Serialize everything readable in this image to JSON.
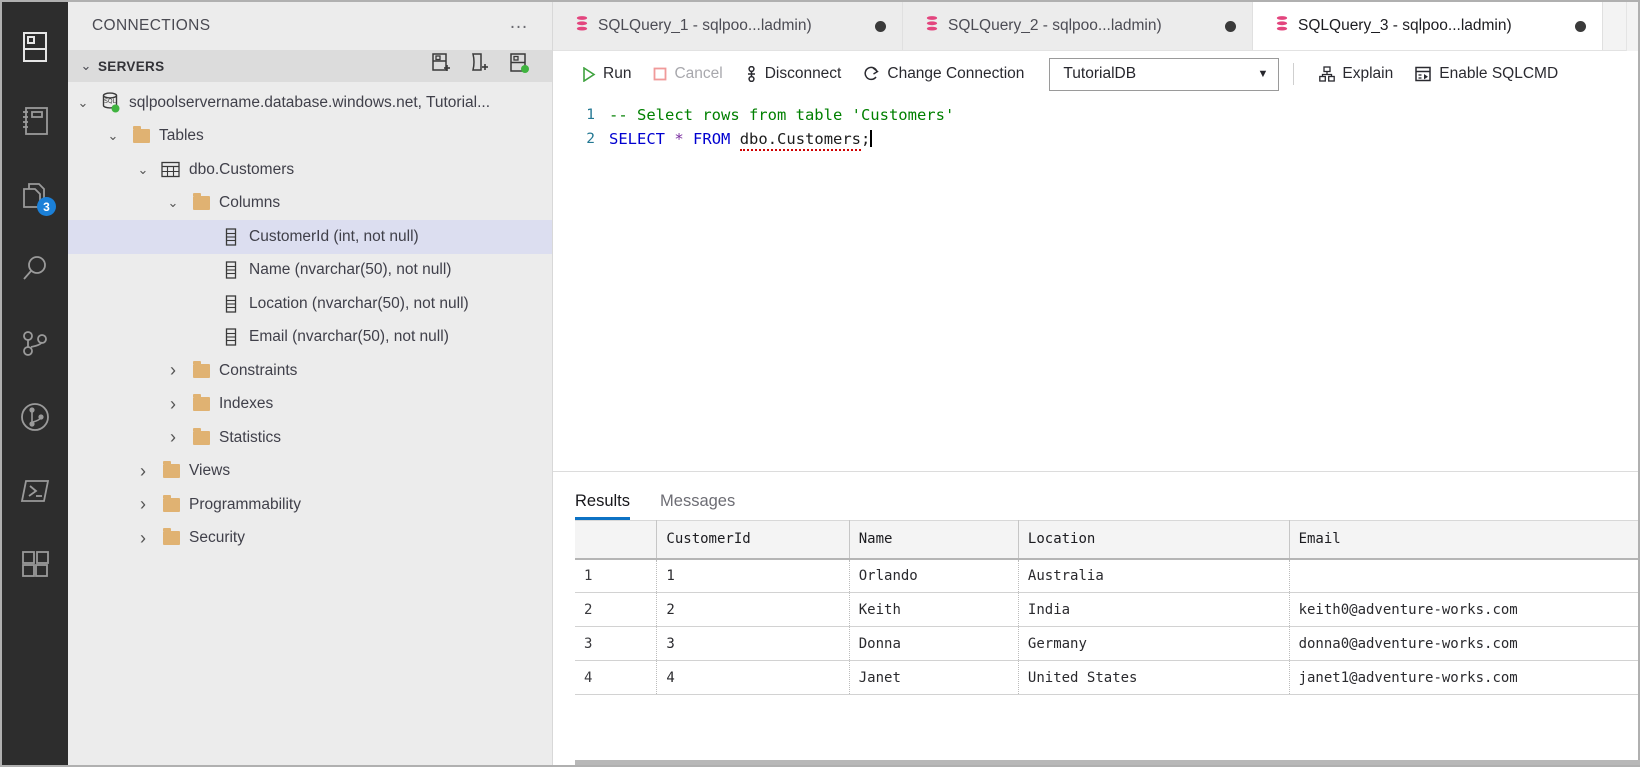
{
  "activity_bar": {
    "items": [
      {
        "name": "servers-icon",
        "label": "Servers"
      },
      {
        "name": "notebooks-icon",
        "label": "Notebooks"
      },
      {
        "name": "source-files-icon",
        "label": "Explorer",
        "badge": "3"
      },
      {
        "name": "search-icon",
        "label": "Search"
      },
      {
        "name": "source-control-icon",
        "label": "Source Control"
      },
      {
        "name": "git-graph-icon",
        "label": "Git Graph"
      },
      {
        "name": "terminal-icon",
        "label": "Terminal"
      },
      {
        "name": "extensions-icon",
        "label": "Extensions"
      }
    ]
  },
  "sidebar": {
    "header_title": "CONNECTIONS",
    "more_label": "…",
    "section_title": "SERVERS",
    "section_actions": [
      {
        "name": "new-connection-icon",
        "label": "New Connection"
      },
      {
        "name": "new-server-group-icon",
        "label": "New Server Group"
      },
      {
        "name": "active-connections-icon",
        "label": "Show Active Connections"
      }
    ],
    "tree": [
      {
        "label": "sqlpoolservername.database.windows.net, Tutorial...",
        "indent": 0,
        "chevron": "⌄",
        "icon": "sql-server-icon",
        "selected": false
      },
      {
        "label": "Tables",
        "indent": 1,
        "chevron": "⌄",
        "icon": "folder-icon",
        "selected": false
      },
      {
        "label": "dbo.Customers",
        "indent": 2,
        "chevron": "⌄",
        "icon": "table-icon",
        "selected": false
      },
      {
        "label": "Columns",
        "indent": 3,
        "chevron": "⌄",
        "icon": "folder-icon",
        "selected": false
      },
      {
        "label": "CustomerId (int, not null)",
        "indent": 4,
        "chevron": "",
        "icon": "column-icon",
        "selected": true
      },
      {
        "label": "Name (nvarchar(50), not null)",
        "indent": 4,
        "chevron": "",
        "icon": "column-icon",
        "selected": false
      },
      {
        "label": "Location (nvarchar(50), not null)",
        "indent": 4,
        "chevron": "",
        "icon": "column-icon",
        "selected": false
      },
      {
        "label": "Email (nvarchar(50), not null)",
        "indent": 4,
        "chevron": "",
        "icon": "column-icon",
        "selected": false
      },
      {
        "label": "Constraints",
        "indent": 3,
        "chevron": "›",
        "icon": "folder-icon",
        "selected": false
      },
      {
        "label": "Indexes",
        "indent": 3,
        "chevron": "›",
        "icon": "folder-icon",
        "selected": false
      },
      {
        "label": "Statistics",
        "indent": 3,
        "chevron": "›",
        "icon": "folder-icon",
        "selected": false
      },
      {
        "label": "Views",
        "indent": 2,
        "chevron": "›",
        "icon": "folder-icon",
        "selected": false
      },
      {
        "label": "Programmability",
        "indent": 2,
        "chevron": "›",
        "icon": "folder-icon",
        "selected": false
      },
      {
        "label": "Security",
        "indent": 2,
        "chevron": "›",
        "icon": "folder-icon",
        "selected": false
      }
    ]
  },
  "tabs": [
    {
      "label": "SQLQuery_1 - sqlpoo...ladmin)",
      "active": false,
      "dirty": true
    },
    {
      "label": "SQLQuery_2 - sqlpoo...ladmin)",
      "active": false,
      "dirty": true
    },
    {
      "label": "SQLQuery_3 - sqlpoo...ladmin)",
      "active": true,
      "dirty": true
    }
  ],
  "toolbar": {
    "run_label": "Run",
    "cancel_label": "Cancel",
    "disconnect_label": "Disconnect",
    "change_connection_label": "Change Connection",
    "database_value": "TutorialDB",
    "explain_label": "Explain",
    "enable_sqlcmd_label": "Enable SQLCMD"
  },
  "editor": {
    "lines": [
      {
        "number": "1",
        "comment": "-- Select rows from table 'Customers'"
      },
      {
        "number": "2",
        "kw1": "SELECT",
        "star": "*",
        "kw2": "FROM",
        "ident": "dbo.Customers",
        "semi": ";"
      }
    ]
  },
  "results": {
    "tabs": [
      {
        "label": "Results",
        "active": true
      },
      {
        "label": "Messages",
        "active": false
      }
    ],
    "columns": [
      "",
      "CustomerId",
      "Name",
      "Location",
      "Email"
    ],
    "rows": [
      {
        "n": "1",
        "CustomerId": "1",
        "Name": "Orlando",
        "Location": "Australia",
        "Email": ""
      },
      {
        "n": "2",
        "CustomerId": "2",
        "Name": "Keith",
        "Location": "India",
        "Email": "keith0@adventure-works.com"
      },
      {
        "n": "3",
        "CustomerId": "3",
        "Name": "Donna",
        "Location": "Germany",
        "Email": "donna0@adventure-works.com"
      },
      {
        "n": "4",
        "CustomerId": "4",
        "Name": "Janet",
        "Location": "United States",
        "Email": "janet1@adventure-works.com"
      }
    ]
  },
  "colors": {
    "accent": "#0d72c4",
    "connected": "#3fb33f",
    "tab_icon": "#e3457e",
    "run_green": "#3fa23f",
    "cancel_pink": "#f09a9a",
    "folder": "#e0b272",
    "badge": "#1b80d8"
  }
}
